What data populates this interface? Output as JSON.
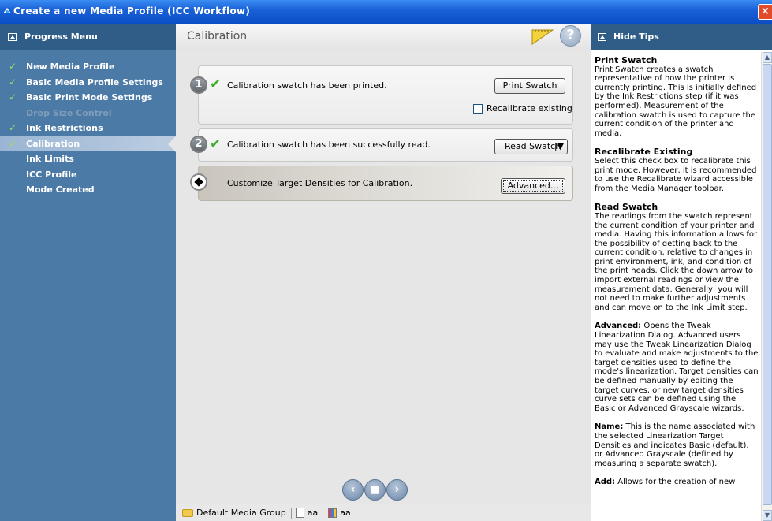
{
  "window": {
    "title": "Create a new Media Profile (ICC Workflow)",
    "close_label": "×"
  },
  "progress": {
    "header": "Progress Menu",
    "items": [
      {
        "label": "New Media Profile",
        "state": "done"
      },
      {
        "label": "Basic Media Profile Settings",
        "state": "done"
      },
      {
        "label": "Basic Print Mode Settings",
        "state": "done"
      },
      {
        "label": "Drop Size Control",
        "state": "disabled"
      },
      {
        "label": "Ink Restrictions",
        "state": "done"
      },
      {
        "label": "Calibration",
        "state": "active"
      },
      {
        "label": "Ink Limits",
        "state": "pending"
      },
      {
        "label": "ICC Profile",
        "state": "pending"
      },
      {
        "label": "Mode Created",
        "state": "pending"
      }
    ]
  },
  "main": {
    "title": "Calibration",
    "step1": {
      "number": "1",
      "text": "Calibration swatch has been printed.",
      "button": "Print Swatch",
      "checkbox_label": "Recalibrate existing",
      "checkbox_checked": false
    },
    "step2": {
      "number": "2",
      "text": "Calibration swatch has been successfully read.",
      "button": "Read Swatch",
      "dropdown_glyph": "|▼"
    },
    "step3": {
      "text": "Customize Target Densities for Calibration.",
      "button": "Advanced..."
    }
  },
  "status": {
    "group": "Default Media Group",
    "item1": "aa",
    "item2": "aa"
  },
  "tips": {
    "header": "Hide Tips",
    "sections": [
      {
        "title": "Print Swatch",
        "body": "Print Swatch creates a swatch representative of how the printer is currently printing. This is initially defined by the Ink Restrictions step (if it was performed). Measurement of the calibration swatch is used to capture the current condition of the printer and media."
      },
      {
        "title": "Recalibrate Existing",
        "body": "Select this check box to recalibrate this print mode. However, it is recommended to use the Recalibrate wizard accessible from the Media Manager toolbar."
      },
      {
        "title": "Read Swatch",
        "body": "The readings from the swatch represent the current condition of your printer and media. Having this information allows for the possibility of getting back to the current condition, relative to changes in print environment, ink, and condition of the print heads. Click the down arrow to import external readings or view the measurement data. Generally, you will not need to make further adjustments and can move on to the Ink Limit step."
      },
      {
        "inline_title": "Advanced:",
        "body": " Opens the Tweak Linearization Dialog. Advanced users may use the Tweak Linearization Dialog to evaluate and make adjustments to the target densities used to define the mode's linearization. Target densities can be defined manually by editing the target curves, or new target densities curve sets can be defined using the Basic or Advanced Grayscale wizards."
      },
      {
        "inline_title": "Name:",
        "body": " This is the name associated with the selected Linearization Target Densities and indicates Basic (default), or Advanced Grayscale (defined by measuring a separate swatch)."
      },
      {
        "inline_title": "Add:",
        "body": " Allows for the creation of new"
      }
    ]
  },
  "colors": {
    "titlebar": "#0b4dc6",
    "panel_dark": "#2f5d88",
    "panel": "#4b7aa7",
    "check": "#3cae2a"
  },
  "icons": {
    "ruler": "ruler-icon",
    "help": "help-icon",
    "back": "back-icon",
    "stop": "stop-icon",
    "forward": "forward-icon"
  }
}
